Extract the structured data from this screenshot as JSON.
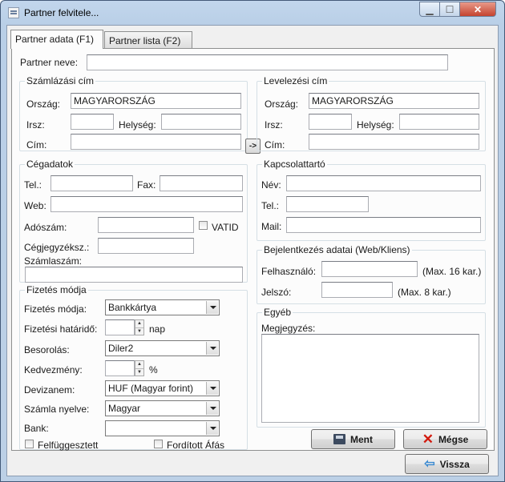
{
  "window": {
    "title": "Partner felvitele...",
    "min": "▁",
    "max": "☐",
    "close": "✕"
  },
  "tabs": [
    {
      "label": "Partner adata (F1)"
    },
    {
      "label": "Partner lista (F2)"
    }
  ],
  "partner": {
    "label": "Partner neve:",
    "value": ""
  },
  "billing": {
    "title": "Számlázási cím",
    "country_label": "Ország:",
    "country": "MAGYARORSZÁG",
    "zip_label": "Irsz:",
    "city_label": "Helység:",
    "address_label": "Cím:",
    "copy_button": "->"
  },
  "mailing": {
    "title": "Levelezési cím",
    "country_label": "Ország:",
    "country": "MAGYARORSZÁG",
    "zip_label": "Irsz:",
    "city_label": "Helység:",
    "address_label": "Cím:"
  },
  "company": {
    "title": "Cégadatok",
    "tel_label": "Tel.:",
    "fax_label": "Fax:",
    "web_label": "Web:",
    "tax_label": "Adószám:",
    "vatid_label": "VATID",
    "regno_label": "Cégjegyzéksz.:",
    "account_label": "Számlaszám:"
  },
  "contact": {
    "title": "Kapcsolattartó",
    "name_label": "Név:",
    "tel_label": "Tel.:",
    "mail_label": "Mail:"
  },
  "login": {
    "title": "Bejelentkezés adatai (Web/Kliens)",
    "user_label": "Felhasználó:",
    "user_hint": "(Max. 16 kar.)",
    "pass_label": "Jelszó:",
    "pass_hint": "(Max. 8 kar.)"
  },
  "payment": {
    "title": "Fizetés módja",
    "method_label": "Fizetés módja:",
    "method": "Bankkártya",
    "deadline_label": "Fizetési határidő:",
    "deadline_unit": "nap",
    "category_label": "Besorolás:",
    "category": "Diler2",
    "discount_label": "Kedvezmény:",
    "discount_unit": "%",
    "currency_label": "Devizanem:",
    "currency": "HUF (Magyar forint)",
    "language_label": "Számla nyelve:",
    "language": "Magyar",
    "bank_label": "Bank:",
    "bank": "",
    "suspended_label": "Felfüggesztett",
    "reverse_vat_label": "Fordított Áfás"
  },
  "other": {
    "title": "Egyéb",
    "notes_label": "Megjegyzés:"
  },
  "buttons": {
    "save": "Ment",
    "cancel": "Mégse",
    "back": "Vissza"
  }
}
